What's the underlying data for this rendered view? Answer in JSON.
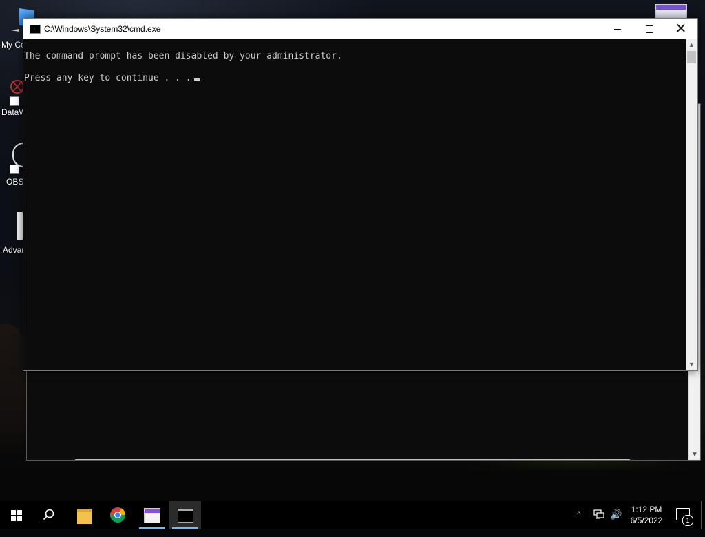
{
  "desktop": {
    "icons": [
      {
        "label": "My Co",
        "name": "my-computer"
      },
      {
        "label": "DataW",
        "name": "datawrapper"
      },
      {
        "label": "OBS",
        "name": "obs"
      },
      {
        "label": "Advan",
        "name": "advanced"
      }
    ]
  },
  "cmd_window": {
    "title": "C:\\Windows\\System32\\cmd.exe",
    "lines": [
      "The command prompt has been disabled by your administrator.",
      "Press any key to continue . . ."
    ],
    "buttons": {
      "minimize": "minimize",
      "maximize": "maximize",
      "close": "✕"
    }
  },
  "taskbar": {
    "apps": [
      {
        "name": "file-explorer",
        "active": false
      },
      {
        "name": "chrome",
        "active": false
      },
      {
        "name": "notepad-app",
        "active": false
      },
      {
        "name": "command-prompt",
        "active": true
      }
    ],
    "clock": {
      "time": "1:12 PM",
      "date": "6/5/2022"
    },
    "notification_count": "1",
    "tray": {
      "chevron": "^",
      "volume": "🔊"
    }
  },
  "colors": {
    "console_bg": "#0c0c0c",
    "console_fg": "#cccccc",
    "taskbar_bg": "#000000",
    "active_underline": "#76b9ed"
  }
}
